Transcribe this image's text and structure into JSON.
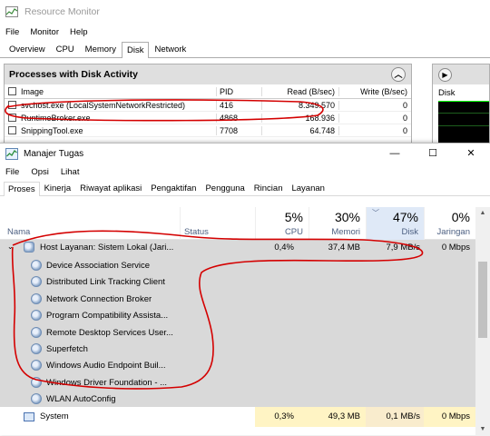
{
  "resource_monitor": {
    "title": "Resource Monitor",
    "menu": [
      "File",
      "Monitor",
      "Help"
    ],
    "tabs": [
      "Overview",
      "CPU",
      "Memory",
      "Disk",
      "Network"
    ],
    "active_tab": "Disk",
    "section_title": "Processes with Disk Activity",
    "columns": {
      "image": "Image",
      "pid": "PID",
      "read": "Read (B/sec)",
      "write": "Write (B/sec)"
    },
    "rows": [
      {
        "image": "svchost.exe (LocalSystemNetworkRestricted)",
        "pid": "416",
        "read": "8.349.570",
        "write": "0"
      },
      {
        "image": "RuntimeBroker.exe",
        "pid": "4868",
        "read": "168.936",
        "write": "0"
      },
      {
        "image": "SnippingTool.exe",
        "pid": "7708",
        "read": "64.748",
        "write": "0"
      }
    ],
    "right_panel_label": "Disk"
  },
  "task_manager": {
    "title": "Manajer Tugas",
    "menu": [
      "File",
      "Opsi",
      "Lihat"
    ],
    "tabs": [
      "Proses",
      "Kinerja",
      "Riwayat aplikasi",
      "Pengaktifan",
      "Pengguna",
      "Rincian",
      "Layanan"
    ],
    "active_tab": "Proses",
    "columns": {
      "name": "Nama",
      "status": "Status",
      "cpu": {
        "pct": "5%",
        "label": "CPU"
      },
      "memory": {
        "pct": "30%",
        "label": "Memori"
      },
      "disk": {
        "pct": "47%",
        "label": "Disk"
      },
      "network": {
        "pct": "0%",
        "label": "Jaringan"
      }
    },
    "group_row": {
      "name": "Host Layanan: Sistem Lokal (Jari...",
      "cpu": "0,4%",
      "memory": "37,4 MB",
      "disk": "7,9 MB/s",
      "network": "0 Mbps"
    },
    "services": [
      "Device Association Service",
      "Distributed Link Tracking Client",
      "Network Connection Broker",
      "Program Compatibility Assista...",
      "Remote Desktop Services User...",
      "Superfetch",
      "Windows Audio Endpoint Buil...",
      "Windows Driver Foundation - ...",
      "WLAN AutoConfig"
    ],
    "system_row": {
      "name": "System",
      "cpu": "0,3%",
      "memory": "49,3 MB",
      "disk": "0,1 MB/s",
      "network": "0 Mbps"
    },
    "window_buttons": {
      "minimize": "—",
      "maximize": "☐",
      "close": "✕"
    }
  },
  "colors": {
    "highlight_row": "#d9d9d9",
    "cpu_band": "#fff4c4",
    "disk_band": "#f9eccd",
    "annotation": "#d40000"
  }
}
